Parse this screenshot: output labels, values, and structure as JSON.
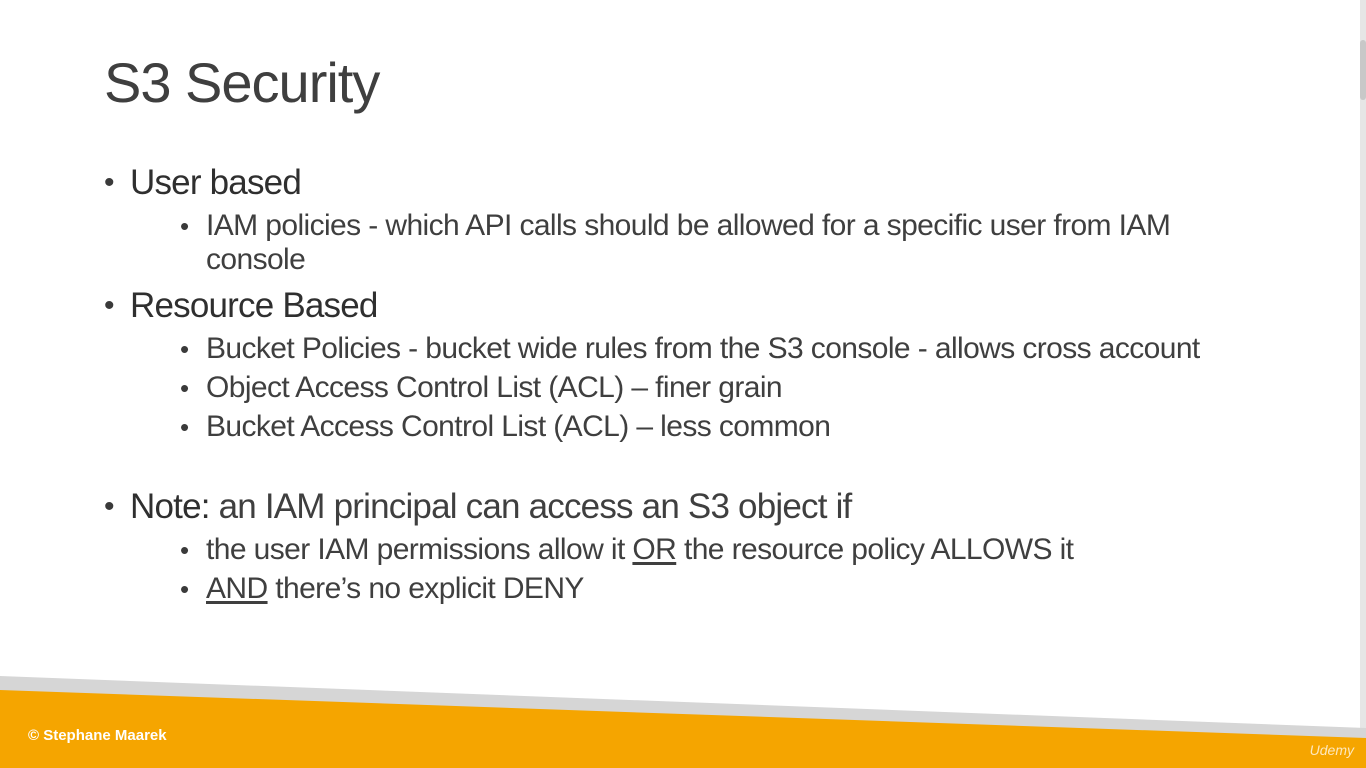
{
  "slide": {
    "title": "S3 Security",
    "sections": [
      {
        "heading": "User based",
        "items": [
          "IAM policies - which API calls should be allowed for a specific user from IAM console"
        ]
      },
      {
        "heading": "Resource Based",
        "items": [
          "Bucket Policies - bucket wide rules from the S3 console - allows cross account",
          "Object Access Control List (ACL) – finer grain",
          "Bucket Access Control List (ACL) – less common"
        ]
      }
    ],
    "note": {
      "label": "Note:",
      "text": " an IAM principal can access an S3 object if",
      "item1": {
        "pre": "the user IAM permissions allow it ",
        "underlined": "OR",
        "post": " the resource policy ALLOWS it"
      },
      "item2": {
        "underlined": "AND",
        "post": " there’s no explicit DENY"
      }
    }
  },
  "footer": {
    "copyright": "© Stephane Maarek",
    "watermark": "Udemy"
  },
  "colors": {
    "accent_orange": "#f5a500",
    "band_gray": "#d6d6d6",
    "text": "#3f3f3f"
  }
}
